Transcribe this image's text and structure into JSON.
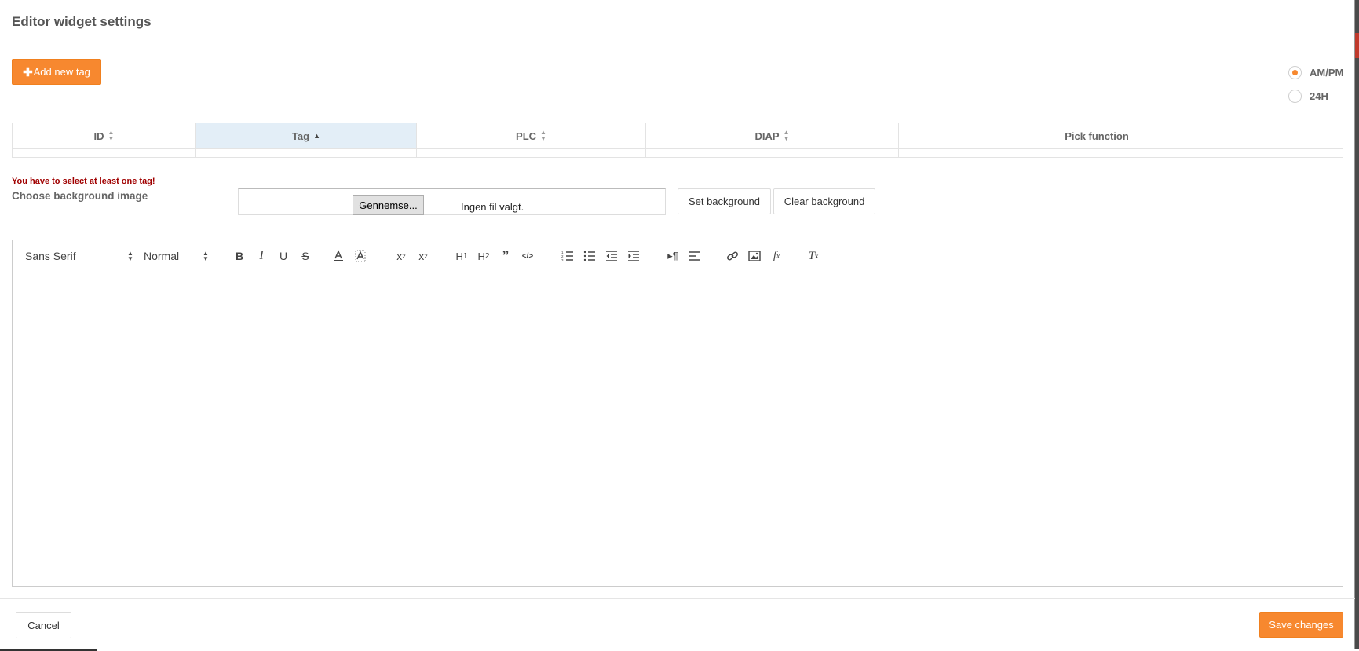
{
  "modal": {
    "title": "Editor widget settings"
  },
  "toolbar_top": {
    "add_tag_icon": "plus-icon",
    "add_tag_label": "Add new tag"
  },
  "time_format": {
    "options": [
      {
        "label": "AM/PM",
        "selected": true
      },
      {
        "label": "24H",
        "selected": false
      }
    ]
  },
  "table": {
    "columns": [
      {
        "label": "ID",
        "sort": "none"
      },
      {
        "label": "Tag",
        "sort": "asc"
      },
      {
        "label": "PLC",
        "sort": "none"
      },
      {
        "label": "DIAP",
        "sort": "none"
      },
      {
        "label": "Pick function",
        "sort": "none"
      },
      {
        "label": "",
        "sort": "none"
      }
    ],
    "rows": []
  },
  "background": {
    "error": "You have to select at least one tag!",
    "label": "Choose background image",
    "browse_label": "Gennemse...",
    "file_status": "Ingen fil valgt.",
    "set_label": "Set background",
    "clear_label": "Clear background"
  },
  "editor": {
    "font_family": "Sans Serif",
    "font_size": "Normal",
    "icons": [
      "bold-icon",
      "italic-icon",
      "underline-icon",
      "strike-icon",
      "text-color-icon",
      "background-color-icon",
      "subscript-icon",
      "superscript-icon",
      "header1-icon",
      "header2-icon",
      "blockquote-icon",
      "code-block-icon",
      "ordered-list-icon",
      "bullet-list-icon",
      "outdent-icon",
      "indent-icon",
      "rtl-direction-icon",
      "align-icon",
      "link-icon",
      "image-icon",
      "formula-icon",
      "clean-format-icon"
    ],
    "content": ""
  },
  "footer": {
    "cancel_label": "Cancel",
    "save_label": "Save changes"
  },
  "colors": {
    "accent": "#f7882f",
    "error": "#a00000",
    "sorted_column_bg": "#e3eef7"
  }
}
